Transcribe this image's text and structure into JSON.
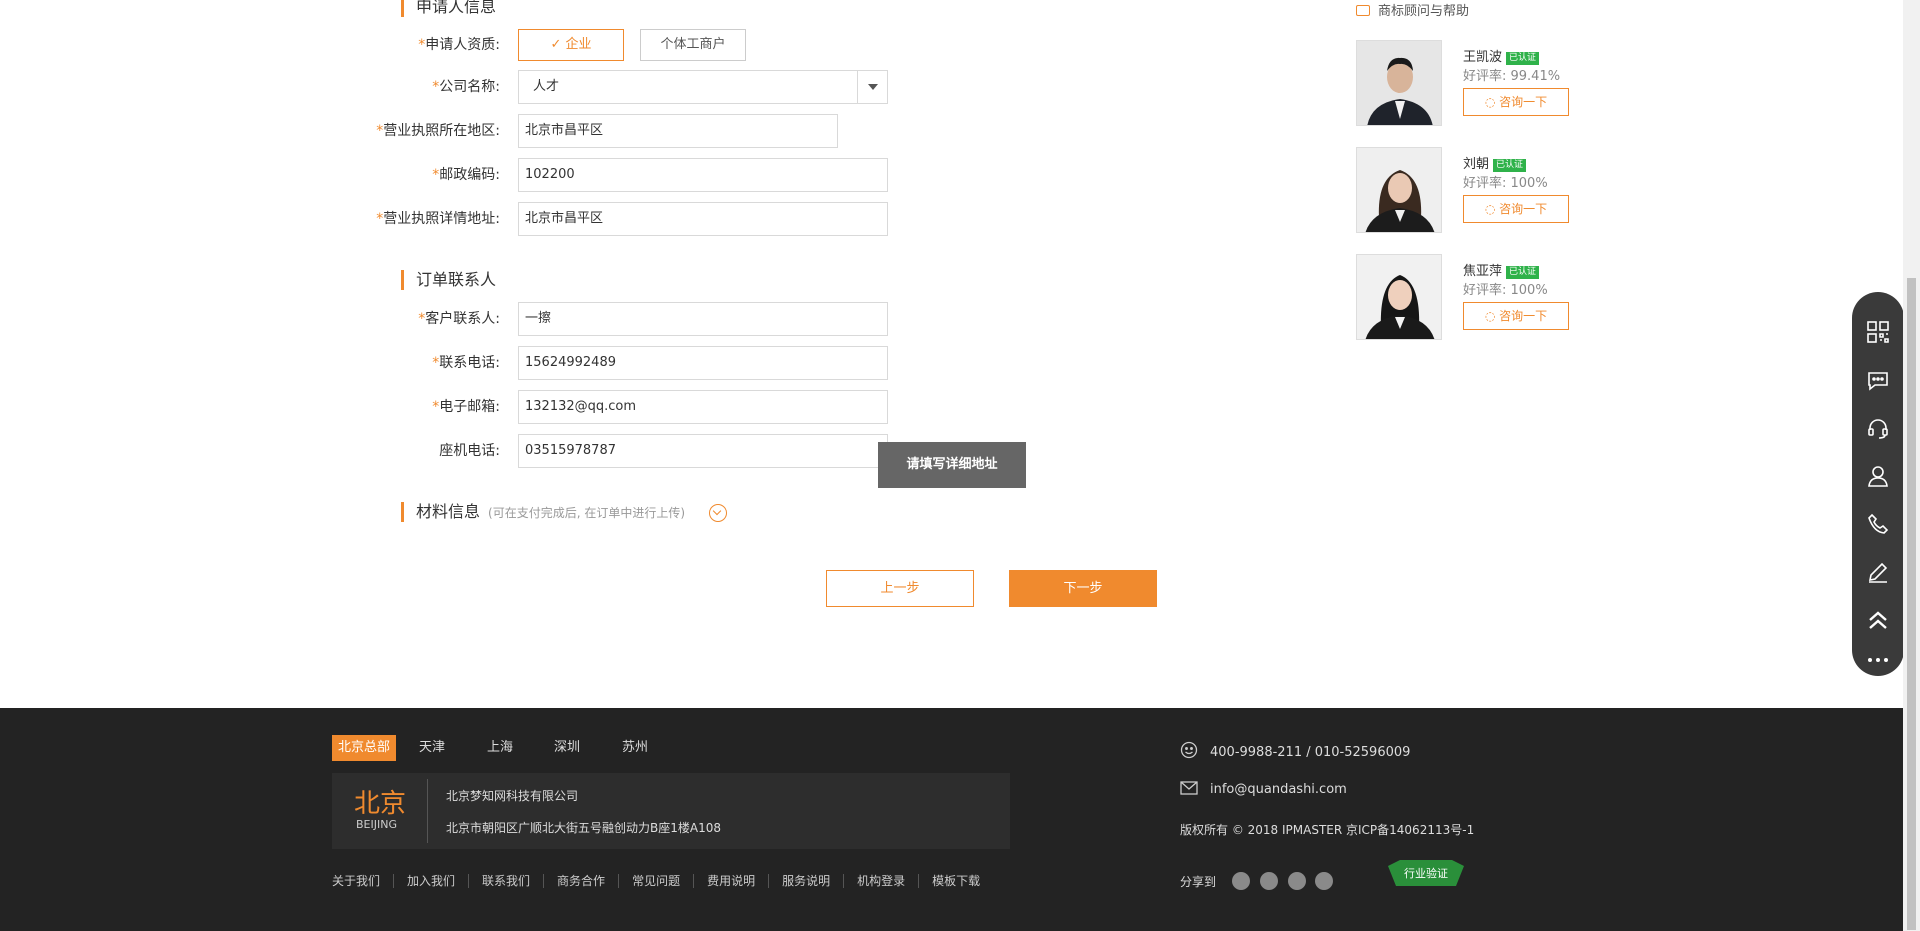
{
  "applicant": {
    "section_title": "申请人信息",
    "qualification": {
      "label": "申请人资质:",
      "options": [
        "企业",
        "个体工商户"
      ],
      "selected": "企业"
    },
    "company_name": {
      "label": "公司名称:",
      "value": "人才"
    },
    "license_region": {
      "label": "营业执照所在地区:",
      "value": "北京市昌平区"
    },
    "postal_code": {
      "label": "邮政编码:",
      "value": "102200"
    },
    "license_address": {
      "label": "营业执照详情地址:",
      "value": "北京市昌平区"
    }
  },
  "contact": {
    "section_title": "订单联系人",
    "customer_contact": {
      "label": "客户联系人:",
      "value": "一擦"
    },
    "phone": {
      "label": "联系电话:",
      "value": "15624992489"
    },
    "email": {
      "label": "电子邮箱:",
      "value": "132132@qq.com"
    },
    "landline": {
      "label": "座机电话:",
      "value": "03515978787"
    }
  },
  "tooltip": "请填写详细地址",
  "materials": {
    "section_title": "材料信息",
    "note": "(可在支付完成后, 在订单中进行上传)"
  },
  "buttons": {
    "prev": "上一步",
    "next": "下一步"
  },
  "advisors": {
    "title": "商标顾问与帮助",
    "badge": "已认证",
    "consult": "咨询一下",
    "list": [
      {
        "name": "王凯波",
        "rate": "好评率: 99.41%"
      },
      {
        "name": "刘朝",
        "rate": "好评率: 100%"
      },
      {
        "name": "焦亚萍",
        "rate": "好评率: 100%"
      }
    ]
  },
  "sidebar_icons": [
    "qrcode-icon",
    "chat-icon",
    "headset-icon",
    "user-icon",
    "phone-icon",
    "edit-icon",
    "back-to-top-icon",
    "more-icon"
  ],
  "footer": {
    "cities": [
      "北京总部",
      "天津",
      "上海",
      "深圳",
      "苏州"
    ],
    "active_city": "北京总部",
    "office": {
      "city_cn": "北京",
      "city_en": "BEIJING",
      "company": "北京梦知网科技有限公司",
      "address": "北京市朝阳区广顺北大街五号融创动力B座1楼A108"
    },
    "links": [
      "关于我们",
      "加入我们",
      "联系我们",
      "商务合作",
      "常见问题",
      "费用说明",
      "服务说明",
      "机构登录",
      "模板下载"
    ],
    "phone": "400-9988-211 / 010-52596009",
    "email": "info@quandashi.com",
    "copyright": "版权所有 © 2018 IPMASTER 京ICP备14062113号-1",
    "share_label": "分享到",
    "verify_badge": "行业验证"
  },
  "colors": {
    "accent": "#f08a2e",
    "footer_bg": "#232323",
    "sidebar_bg": "#3a3a3a",
    "certified": "#2fb24a"
  }
}
